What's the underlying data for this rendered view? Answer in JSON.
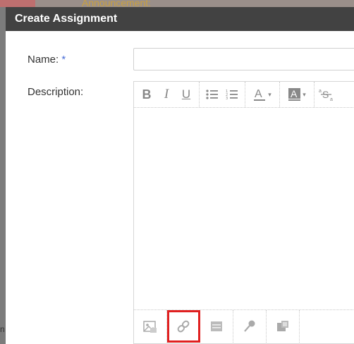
{
  "background": {
    "announcement": "Announcement:",
    "left_char": "n"
  },
  "modal": {
    "title": "Create Assignment",
    "name_label": "Name:",
    "required_marker": "*",
    "name_value": "",
    "description_label": "Description:"
  },
  "toolbar": {
    "bold": "B",
    "italic": "I",
    "underline": "U",
    "font_color_letter": "A",
    "highlight_letter": "A",
    "strike_sup": "a",
    "strike_main": "S",
    "strike_sub": "a",
    "caret": "▾"
  },
  "bottom_toolbar": {
    "items": [
      "insert-image-icon",
      "insert-link-icon",
      "insert-table-icon",
      "record-audio-icon",
      "insert-embed-icon"
    ],
    "highlighted": "insert-link-icon",
    "highlight_color": "#e02020"
  },
  "colors": {
    "header_bg": "#424242",
    "required": "#4a6fd6",
    "backdrop": "#8f8f8f"
  }
}
